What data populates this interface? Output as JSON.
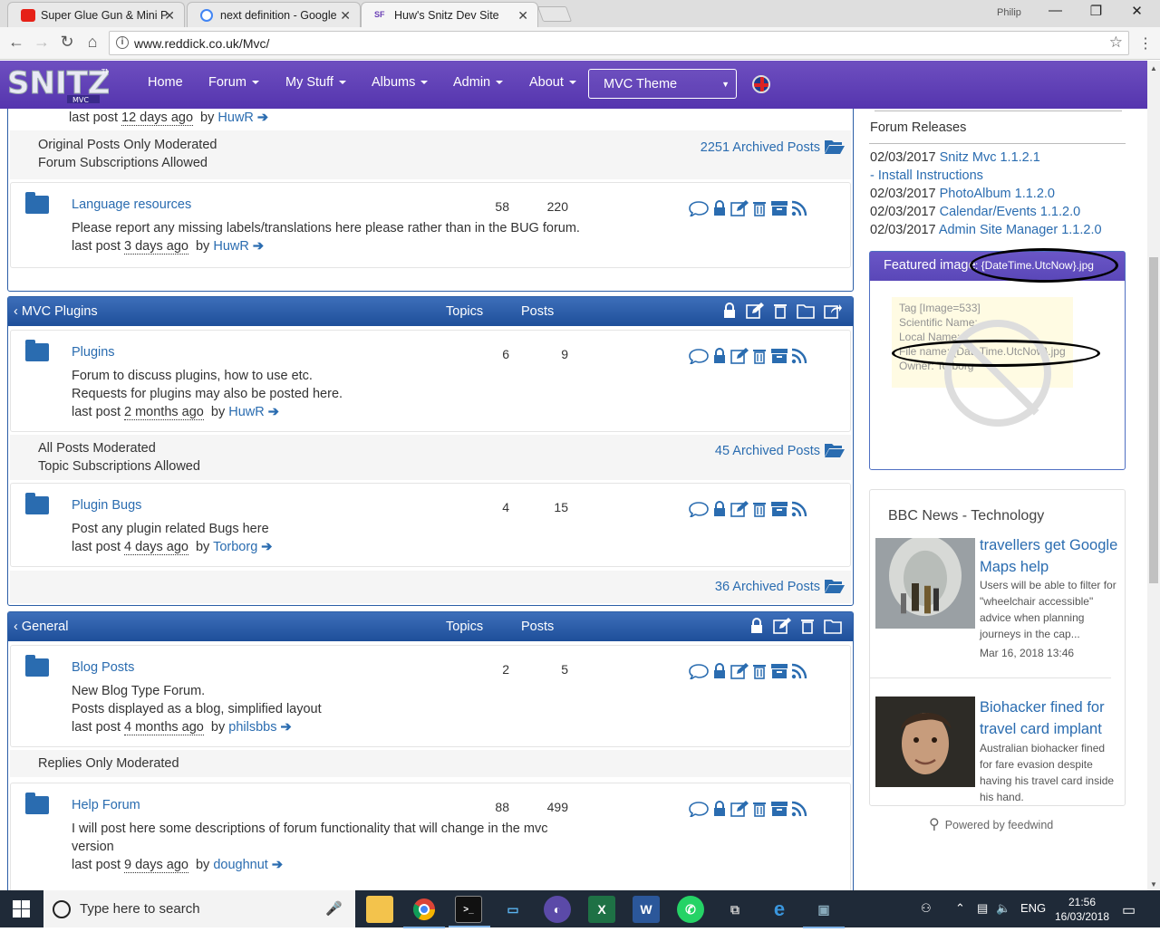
{
  "browser": {
    "tabs": [
      {
        "title": "Super Glue Gun & Mini P",
        "favicon": "youtube-icon",
        "color": "#e62117"
      },
      {
        "title": "next definition - Google",
        "favicon": "google-icon",
        "color": "#4285f4"
      },
      {
        "title": "Huw's Snitz Dev Site",
        "favicon": "snitz-icon",
        "color": "#6a3fb5"
      }
    ],
    "profile_name": "Philip",
    "url": "www.reddick.co.uk/Mvc/"
  },
  "site": {
    "logo_text": "SNITZ",
    "logo_sub": "MVC",
    "logo_tm": "TM",
    "nav": [
      "Home",
      "Forum",
      "My Stuff",
      "Albums",
      "Admin",
      "About"
    ],
    "theme_select": "MVC Theme"
  },
  "forum": {
    "top_lastpost": {
      "label": "last post",
      "ago": "12 days ago",
      "by": "by",
      "author": "HuwR"
    },
    "strip1": {
      "line1": "Original Posts Only Moderated",
      "line2": "Forum Subscriptions Allowed",
      "archived": "2251 Archived Posts"
    },
    "language": {
      "name": "Language resources",
      "topics": "58",
      "posts": "220",
      "desc": "Please report any missing labels/translations here please rather than in the BUG forum.",
      "label": "last post",
      "ago": "3 days ago",
      "by": "by",
      "author": "HuwR"
    },
    "cat_plugins": {
      "title": "MVC Plugins",
      "topics": "Topics",
      "posts": "Posts"
    },
    "plugins": {
      "name": "Plugins",
      "topics": "6",
      "posts": "9",
      "desc1": "Forum to discuss plugins, how to use etc.",
      "desc2": "Requests for plugins may also be posted here.",
      "label": "last post",
      "ago": "2 months ago",
      "by": "by",
      "author": "HuwR"
    },
    "strip2": {
      "line1": "All Posts Moderated",
      "line2": "Topic Subscriptions Allowed",
      "archived": "45 Archived Posts"
    },
    "pluginbugs": {
      "name": "Plugin Bugs",
      "topics": "4",
      "posts": "15",
      "desc": "Post any plugin related Bugs here",
      "label": "last post",
      "ago": "4 days ago",
      "by": "by",
      "author": "Torborg"
    },
    "strip3": {
      "archived": "36 Archived Posts"
    },
    "cat_general": {
      "title": "General",
      "topics": "Topics",
      "posts": "Posts"
    },
    "blog": {
      "name": "Blog Posts",
      "topics": "2",
      "posts": "5",
      "desc1": "New Blog Type Forum.",
      "desc2": "Posts displayed as a blog, simplified layout",
      "label": "last post",
      "ago": "4 months ago",
      "by": "by",
      "author": "philsbbs"
    },
    "strip4": {
      "line1": "Replies Only Moderated"
    },
    "help": {
      "name": "Help Forum",
      "topics": "88",
      "posts": "499",
      "desc1": "I will post here some descriptions of forum functionality that will change in the mvc",
      "desc2": "version",
      "label": "last post",
      "ago": "9 days ago",
      "by": "by",
      "author": "doughnut"
    }
  },
  "sidebar": {
    "releases_title": "Forum Releases",
    "releases": [
      {
        "date": "02/03/2017",
        "link": "Snitz Mvc 1.1.2.1"
      },
      {
        "date": "",
        "link": "- Install Instructions"
      },
      {
        "date": "02/03/2017",
        "link": "PhotoAlbum 1.1.2.0"
      },
      {
        "date": "02/03/2017",
        "link": "Calendar/Events 1.1.2.0"
      },
      {
        "date": "02/03/2017",
        "link": "Admin Site Manager 1.1.2.0"
      }
    ],
    "featured_title": "Featured image",
    "featured_file": ": {DateTime.UtcNow}.jpg",
    "photo": {
      "tag": "Tag [Image=533]",
      "scientific": "Scientific Name:",
      "local": "Local Name:",
      "filename": "File name: {DateTime.UtcNow}.jpg",
      "owner": "Owner: Torborg"
    },
    "bbc_title": "BBC News - Technology",
    "news": [
      {
        "headline": "travellers get Google Maps help",
        "text": "Users will be able to filter for \"wheelchair accessible\" advice when planning journeys in the cap...",
        "date": "Mar 16, 2018 13:46"
      },
      {
        "headline": "Biohacker fined for travel card implant",
        "text": "Australian biohacker fined for fare evasion despite having his travel card inside his hand."
      }
    ],
    "powered": "Powered by feedwind"
  },
  "taskbar": {
    "search_placeholder": "Type here to search",
    "lang": "ENG",
    "time": "21:56",
    "date": "16/03/2018"
  }
}
